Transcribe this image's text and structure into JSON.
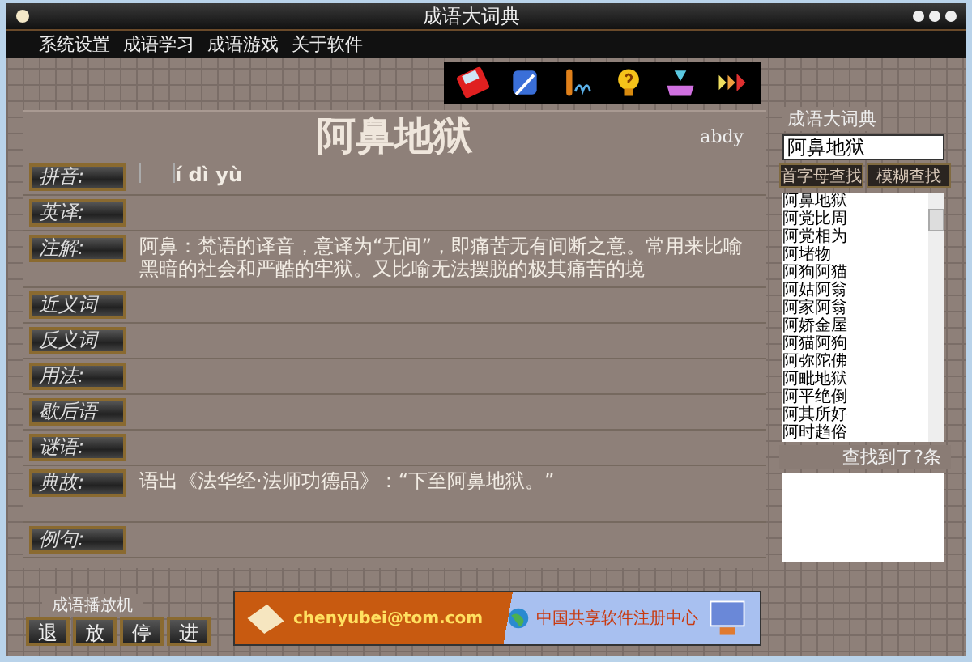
{
  "window": {
    "title": "成语大词典"
  },
  "menu": [
    "系统设置",
    "成语学习",
    "成语游戏",
    "关于软件"
  ],
  "entry": {
    "idiom": "阿鼻地狱",
    "abbreviation": "abdy"
  },
  "fields": [
    {
      "label": "拼音:",
      "value": "í dì yù",
      "kind": "pinyin"
    },
    {
      "label": "英译:",
      "kind": "line"
    },
    {
      "label": "注解:",
      "value": "阿鼻：梵语的译音，意译为“无间”，即痛苦无有间断之意。常用来比喻黑暗的社会和严酷的牢狱。又比喻无法摆脱的极其痛苦的境",
      "kind": "para"
    },
    {
      "label": "近义词",
      "kind": "line"
    },
    {
      "label": "反义词",
      "kind": "line"
    },
    {
      "label": "用法:",
      "kind": "line"
    },
    {
      "label": "歇后语",
      "kind": "line"
    },
    {
      "label": "谜语:",
      "kind": "line"
    },
    {
      "label": "典故:",
      "value": "语出《法华经·法师功德品》：“下至阿鼻地狱。”",
      "kind": "para"
    },
    {
      "label": "例句:",
      "kind": "line"
    }
  ],
  "sidebar": {
    "title": "成语大词典",
    "search_value": "阿鼻地狱",
    "buttons": [
      "首字母查找",
      "模糊查找"
    ],
    "results": [
      "阿鼻地狱",
      "阿党比周",
      "阿党相为",
      "阿堵物",
      "阿狗阿猫",
      "阿姑阿翁",
      "阿家阿翁",
      "阿娇金屋",
      "阿猫阿狗",
      "阿弥陀佛",
      "阿毗地狱",
      "阿平绝倒",
      "阿其所好",
      "阿时趋俗"
    ],
    "count_text": "查找到了?条"
  },
  "player": {
    "title": "成语播放机",
    "buttons": [
      "退",
      "放",
      "停",
      "进"
    ]
  },
  "banner": {
    "email": "chenyubei@tom.com",
    "caption": "中国共享软件注册中心"
  }
}
